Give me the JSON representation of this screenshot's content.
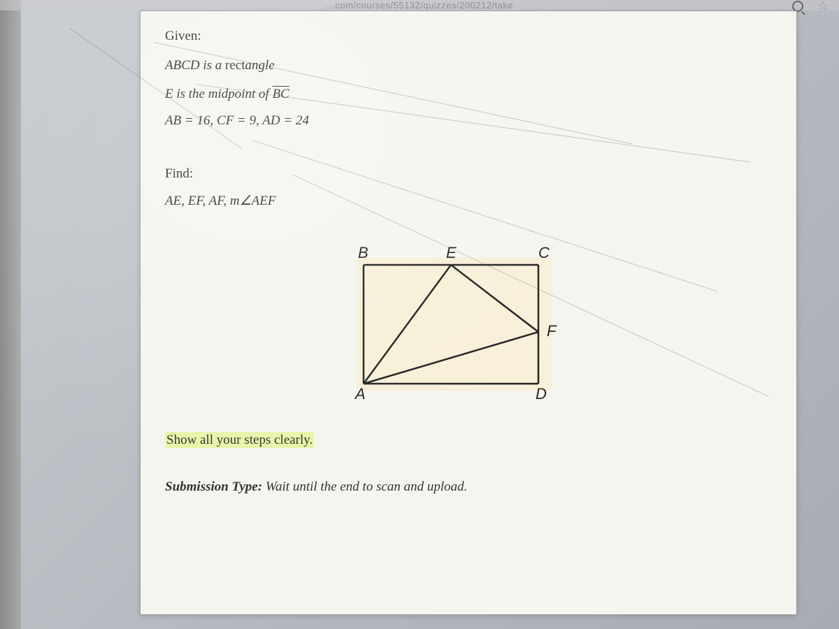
{
  "browser": {
    "url_fragment": "…com/courses/55132/quizzes/200212/take"
  },
  "problem": {
    "given_label": "Given:",
    "given_line1_prefix": "ABCD is a ",
    "given_line1_word": "rect",
    "given_line1_suffix": "angle",
    "given_line2_prefix": "E is the midpoint of ",
    "given_line2_segment": "BC",
    "given_line3": "AB = 16, CF = 9, AD = 24",
    "find_label": "Find:",
    "find_line": "AE, EF, AF, m∠AEF",
    "diagram_points": {
      "B": "B",
      "E": "E",
      "C": "C",
      "A": "A",
      "D": "D",
      "F": "F"
    },
    "instruction": "Show all your steps clearly.",
    "submission_label": "Submission Type:",
    "submission_text": " Wait until the end to scan and upload."
  }
}
